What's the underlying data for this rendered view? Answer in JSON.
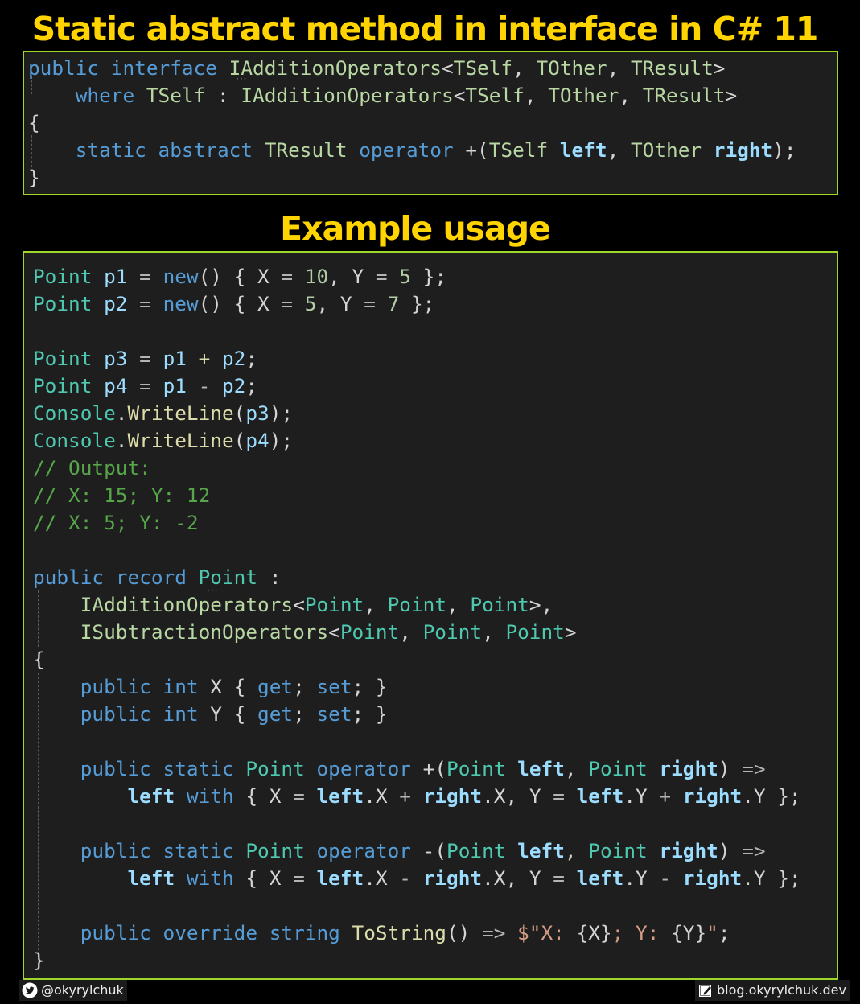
{
  "title": "Static abstract method in interface in C# 11",
  "subtitle": "Example usage",
  "colors": {
    "title": "#ffd400",
    "border": "#9dd72a",
    "code_background": "#1e1e1e",
    "keyword": "#569cd6",
    "type": "#4ec9b0",
    "interface": "#b8d7a3",
    "variable": "#9cdcfe",
    "number": "#b5cea8",
    "method": "#dcdcaa",
    "comment": "#57a64a",
    "string": "#d69d85"
  },
  "interface_code": {
    "lines": [
      [
        [
          "kw",
          "public"
        ],
        [
          "pu",
          " "
        ],
        [
          "kw",
          "interface"
        ],
        [
          "pu",
          " "
        ],
        [
          "if",
          "IAdditionOperators"
        ],
        [
          "pu",
          "<"
        ],
        [
          "tp",
          "TSelf"
        ],
        [
          "pu",
          ", "
        ],
        [
          "tp",
          "TOther"
        ],
        [
          "pu",
          ", "
        ],
        [
          "tp",
          "TResult"
        ],
        [
          "pu",
          ">"
        ]
      ],
      [
        [
          "pu",
          "    "
        ],
        [
          "kw",
          "where"
        ],
        [
          "pu",
          " "
        ],
        [
          "tp",
          "TSelf"
        ],
        [
          "pu",
          " : "
        ],
        [
          "if",
          "IAdditionOperators"
        ],
        [
          "pu",
          "<"
        ],
        [
          "tp",
          "TSelf"
        ],
        [
          "pu",
          ", "
        ],
        [
          "tp",
          "TOther"
        ],
        [
          "pu",
          ", "
        ],
        [
          "tp",
          "TResult"
        ],
        [
          "pu",
          ">"
        ]
      ],
      [
        [
          "br",
          "{"
        ]
      ],
      [
        [
          "pu",
          "    "
        ],
        [
          "kw",
          "static"
        ],
        [
          "pu",
          " "
        ],
        [
          "kw",
          "abstract"
        ],
        [
          "pu",
          " "
        ],
        [
          "tp",
          "TResult"
        ],
        [
          "pu",
          " "
        ],
        [
          "kw",
          "operator"
        ],
        [
          "pu",
          " +("
        ],
        [
          "tp",
          "TSelf"
        ],
        [
          "pu",
          " "
        ],
        [
          "va",
          "left"
        ],
        [
          "pu",
          ", "
        ],
        [
          "tp",
          "TOther"
        ],
        [
          "pu",
          " "
        ],
        [
          "va",
          "right"
        ],
        [
          "pu",
          ");"
        ]
      ],
      [
        [
          "br",
          "}"
        ]
      ]
    ]
  },
  "example_code": {
    "lines": [
      [
        [
          "ty",
          "Point"
        ],
        [
          "pu",
          " "
        ],
        [
          "va",
          "p1"
        ],
        [
          "op",
          " = "
        ],
        [
          "kw",
          "new"
        ],
        [
          "pu",
          "() { X "
        ],
        [
          "op",
          "="
        ],
        [
          "pu",
          " "
        ],
        [
          "nu",
          "10"
        ],
        [
          "pu",
          ", Y "
        ],
        [
          "op",
          "="
        ],
        [
          "pu",
          " "
        ],
        [
          "nu",
          "5"
        ],
        [
          "pu",
          " };"
        ]
      ],
      [
        [
          "ty",
          "Point"
        ],
        [
          "pu",
          " "
        ],
        [
          "va",
          "p2"
        ],
        [
          "op",
          " = "
        ],
        [
          "kw",
          "new"
        ],
        [
          "pu",
          "() { X "
        ],
        [
          "op",
          "="
        ],
        [
          "pu",
          " "
        ],
        [
          "nu",
          "5"
        ],
        [
          "pu",
          ", Y "
        ],
        [
          "op",
          "="
        ],
        [
          "pu",
          " "
        ],
        [
          "nu",
          "7"
        ],
        [
          "pu",
          " };"
        ]
      ],
      [],
      [
        [
          "ty",
          "Point"
        ],
        [
          "pu",
          " "
        ],
        [
          "va",
          "p3"
        ],
        [
          "op",
          " = "
        ],
        [
          "va",
          "p1"
        ],
        [
          "mt",
          " + "
        ],
        [
          "va",
          "p2"
        ],
        [
          "pu",
          ";"
        ]
      ],
      [
        [
          "ty",
          "Point"
        ],
        [
          "pu",
          " "
        ],
        [
          "va",
          "p4"
        ],
        [
          "op",
          " = "
        ],
        [
          "va",
          "p1"
        ],
        [
          "op",
          " - "
        ],
        [
          "va",
          "p2"
        ],
        [
          "pu",
          ";"
        ]
      ],
      [
        [
          "ty",
          "Console"
        ],
        [
          "pu",
          "."
        ],
        [
          "mt",
          "WriteLine"
        ],
        [
          "pu",
          "("
        ],
        [
          "va",
          "p3"
        ],
        [
          "pu",
          ");"
        ]
      ],
      [
        [
          "ty",
          "Console"
        ],
        [
          "pu",
          "."
        ],
        [
          "mt",
          "WriteLine"
        ],
        [
          "pu",
          "("
        ],
        [
          "va",
          "p4"
        ],
        [
          "pu",
          ");"
        ]
      ],
      [
        [
          "cm",
          "// Output:"
        ]
      ],
      [
        [
          "cm",
          "// X: 15; Y: 12"
        ]
      ],
      [
        [
          "cm",
          "// X: 5; Y: -2"
        ]
      ],
      [],
      [
        [
          "kw",
          "public"
        ],
        [
          "pu",
          " "
        ],
        [
          "kw",
          "record"
        ],
        [
          "pu",
          " "
        ],
        [
          "ty",
          "Point"
        ],
        [
          "pu",
          " :"
        ]
      ],
      [
        [
          "pu",
          "    "
        ],
        [
          "if",
          "IAdditionOperators"
        ],
        [
          "pu",
          "<"
        ],
        [
          "ty",
          "Point"
        ],
        [
          "pu",
          ", "
        ],
        [
          "ty",
          "Point"
        ],
        [
          "pu",
          ", "
        ],
        [
          "ty",
          "Point"
        ],
        [
          "pu",
          ">,"
        ]
      ],
      [
        [
          "pu",
          "    "
        ],
        [
          "if",
          "ISubtractionOperators"
        ],
        [
          "pu",
          "<"
        ],
        [
          "ty",
          "Point"
        ],
        [
          "pu",
          ", "
        ],
        [
          "ty",
          "Point"
        ],
        [
          "pu",
          ", "
        ],
        [
          "ty",
          "Point"
        ],
        [
          "pu",
          ">"
        ]
      ],
      [
        [
          "br",
          "{"
        ]
      ],
      [
        [
          "pu",
          "    "
        ],
        [
          "kw",
          "public"
        ],
        [
          "pu",
          " "
        ],
        [
          "kw",
          "int"
        ],
        [
          "pu",
          " X { "
        ],
        [
          "kw",
          "get"
        ],
        [
          "pu",
          "; "
        ],
        [
          "kw",
          "set"
        ],
        [
          "pu",
          "; }"
        ]
      ],
      [
        [
          "pu",
          "    "
        ],
        [
          "kw",
          "public"
        ],
        [
          "pu",
          " "
        ],
        [
          "kw",
          "int"
        ],
        [
          "pu",
          " Y { "
        ],
        [
          "kw",
          "get"
        ],
        [
          "pu",
          "; "
        ],
        [
          "kw",
          "set"
        ],
        [
          "pu",
          "; }"
        ]
      ],
      [],
      [
        [
          "pu",
          "    "
        ],
        [
          "kw",
          "public"
        ],
        [
          "pu",
          " "
        ],
        [
          "kw",
          "static"
        ],
        [
          "pu",
          " "
        ],
        [
          "ty",
          "Point"
        ],
        [
          "pu",
          " "
        ],
        [
          "kw",
          "operator"
        ],
        [
          "pu",
          " +("
        ],
        [
          "ty",
          "Point"
        ],
        [
          "pu",
          " "
        ],
        [
          "va",
          "left"
        ],
        [
          "pu",
          ", "
        ],
        [
          "ty",
          "Point"
        ],
        [
          "pu",
          " "
        ],
        [
          "va",
          "right"
        ],
        [
          "pu",
          ") "
        ],
        [
          "op",
          "=>"
        ]
      ],
      [
        [
          "pu",
          "        "
        ],
        [
          "va",
          "left"
        ],
        [
          "pu",
          " "
        ],
        [
          "kw",
          "with"
        ],
        [
          "pu",
          " { X "
        ],
        [
          "op",
          "="
        ],
        [
          "pu",
          " "
        ],
        [
          "va",
          "left"
        ],
        [
          "pu",
          ".X "
        ],
        [
          "op",
          "+"
        ],
        [
          "pu",
          " "
        ],
        [
          "va",
          "right"
        ],
        [
          "pu",
          ".X, Y "
        ],
        [
          "op",
          "="
        ],
        [
          "pu",
          " "
        ],
        [
          "va",
          "left"
        ],
        [
          "pu",
          ".Y "
        ],
        [
          "op",
          "+"
        ],
        [
          "pu",
          " "
        ],
        [
          "va",
          "right"
        ],
        [
          "pu",
          ".Y };"
        ]
      ],
      [],
      [
        [
          "pu",
          "    "
        ],
        [
          "kw",
          "public"
        ],
        [
          "pu",
          " "
        ],
        [
          "kw",
          "static"
        ],
        [
          "pu",
          " "
        ],
        [
          "ty",
          "Point"
        ],
        [
          "pu",
          " "
        ],
        [
          "kw",
          "operator"
        ],
        [
          "pu",
          " -("
        ],
        [
          "ty",
          "Point"
        ],
        [
          "pu",
          " "
        ],
        [
          "va",
          "left"
        ],
        [
          "pu",
          ", "
        ],
        [
          "ty",
          "Point"
        ],
        [
          "pu",
          " "
        ],
        [
          "va",
          "right"
        ],
        [
          "pu",
          ") "
        ],
        [
          "op",
          "=>"
        ]
      ],
      [
        [
          "pu",
          "        "
        ],
        [
          "va",
          "left"
        ],
        [
          "pu",
          " "
        ],
        [
          "kw",
          "with"
        ],
        [
          "pu",
          " { X "
        ],
        [
          "op",
          "="
        ],
        [
          "pu",
          " "
        ],
        [
          "va",
          "left"
        ],
        [
          "pu",
          ".X "
        ],
        [
          "op",
          "-"
        ],
        [
          "pu",
          " "
        ],
        [
          "va",
          "right"
        ],
        [
          "pu",
          ".X, Y "
        ],
        [
          "op",
          "="
        ],
        [
          "pu",
          " "
        ],
        [
          "va",
          "left"
        ],
        [
          "pu",
          ".Y "
        ],
        [
          "op",
          "-"
        ],
        [
          "pu",
          " "
        ],
        [
          "va",
          "right"
        ],
        [
          "pu",
          ".Y };"
        ]
      ],
      [],
      [
        [
          "pu",
          "    "
        ],
        [
          "kw",
          "public"
        ],
        [
          "pu",
          " "
        ],
        [
          "kw",
          "override"
        ],
        [
          "pu",
          " "
        ],
        [
          "kw",
          "string"
        ],
        [
          "pu",
          " "
        ],
        [
          "mt",
          "ToString"
        ],
        [
          "pu",
          "() "
        ],
        [
          "op",
          "=>"
        ],
        [
          "pu",
          " "
        ],
        [
          "st",
          "$\"X: "
        ],
        [
          "pu",
          "{X}"
        ],
        [
          "st",
          "; Y: "
        ],
        [
          "pu",
          "{Y}"
        ],
        [
          "st",
          "\""
        ],
        [
          "pu",
          ";"
        ]
      ],
      [
        [
          "br",
          "}"
        ]
      ]
    ]
  },
  "footer": {
    "twitter_icon": "twitter-bird-icon",
    "twitter_handle": "@okyrylchuk",
    "blog_icon": "edit-note-icon",
    "blog_url_text": "blog.okyrylchuk.dev"
  }
}
